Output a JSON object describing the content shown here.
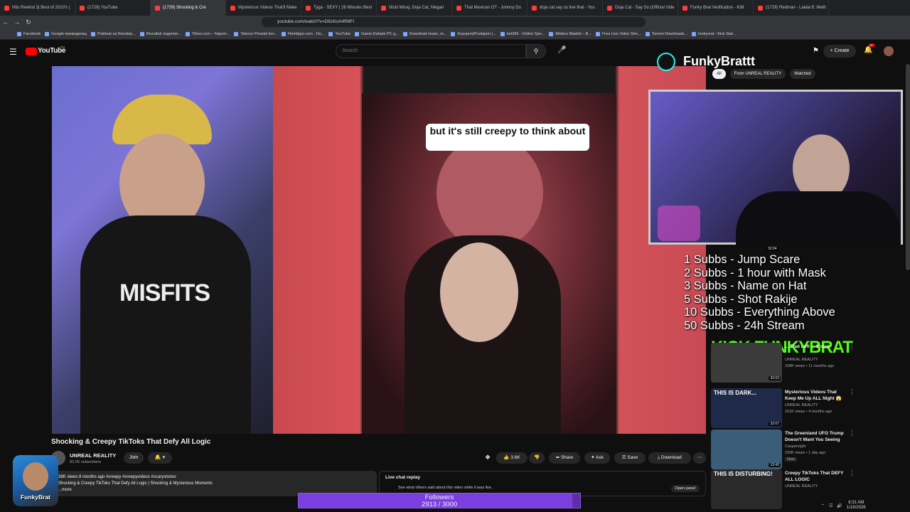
{
  "browser": {
    "tabs": [
      {
        "label": "Hits Rewind 3| Best of 2010's |"
      },
      {
        "label": "(1729) YouTube"
      },
      {
        "label": "(1729) Shocking & Cre",
        "active": true
      },
      {
        "label": "Mysterious Videos That'll Make"
      },
      {
        "label": "Tyga - SEXY | 26 Minutes Best"
      },
      {
        "label": "Nicki Minaj, Doja Cat, Megan"
      },
      {
        "label": "That Mexican OT - Johnny Do"
      },
      {
        "label": "doja cat say so live that - You"
      },
      {
        "label": "Doja Cat - Say So (Official Vide"
      },
      {
        "label": "Funky Brat Verification - Kittl"
      },
      {
        "label": "(1729) Redman - Lalala ft. Meth"
      }
    ],
    "url": "youtube.com/watch?v=D61KvA4R8FI",
    "bookmarks": [
      "Facebook",
      "Google преводилац",
      "Poklони za Nonstop...",
      "Rezultati nogomet...",
      "Titlovi.com – Najveć...",
      "Telenor Privatni kor...",
      "FileHippo.com - Do...",
      "YouTube",
      "Game-Debate PC g...",
      "Download music, m...",
      "Kupujem|Prodajem |...",
      "bet365 - Online Spo...",
      "Atletico Madrid – B...",
      "Free Live Video Stre...",
      "Torrent Downloads...",
      "funkyvrat - Kick Stat..."
    ]
  },
  "youtube": {
    "logo": "YouTube",
    "region": "RS",
    "search_placeholder": "Search",
    "create_label": "Create",
    "notif_count": "9+"
  },
  "video": {
    "caption": "but it's still creepy to think about",
    "title": "Shocking & Creepy TikToks That Defy All Logic",
    "channel": "UNREAL REALITY",
    "subscribers": "93.2K subscribers",
    "join_label": "Join",
    "likes": "3.6K",
    "share_label": "Share",
    "ask_label": "Ask",
    "save_label": "Save",
    "download_label": "Download",
    "desc_meta": "38K views  8 months ago  #creepy #creepyvideos #scarystories",
    "desc_text": "Shocking & Creepy TikToks That Defy All Logic | Shocking & Mysterious Moments",
    "desc_more": "...more"
  },
  "live_chat": {
    "title": "Live chat replay",
    "subtitle": "See what others said about this video while it was live.",
    "open_label": "Open panel"
  },
  "overlay": {
    "tiktok_name": "FunkyBrattt",
    "goals": [
      "1 Subbs - Jump Scare",
      "2 Subbs - 1 hour with Mask",
      "3 Subbs - Name on Hat",
      "5 Subbs - Shot Rakije",
      "10 Subbs - Everything Above",
      "50 Subbs - 24h Stream"
    ],
    "kick_text": "KICK FUNKYBRAT",
    "followers_label": "Followers",
    "followers_value": "2913 / 3000",
    "followers_fraction": 0.971,
    "badge_name": "FunkyBrat"
  },
  "sidebar": {
    "chips": [
      "All",
      "From UNREAL REALITY",
      "Watched"
    ],
    "recs": [
      {
        "title": "... That Left ... Shock",
        "channel": "UNREAL REALITY",
        "meta": "108K views • 11 months ago",
        "duration": "32:03"
      },
      {
        "title": "Mysterious Videos That Keep Me Up ALL Night 😱",
        "channel": "UNREAL REALITY",
        "meta": "101K views • 4 months ago",
        "duration": "32:07",
        "thumb_text": "THIS IS DARK..."
      },
      {
        "title": "The Greenland UFO Trump Doesn't Want You Seeing",
        "channel": "Caspersight",
        "meta": "233K views • 1 day ago",
        "badge": "New",
        "duration": "13:42"
      },
      {
        "title": "Creepy TikToks That DEFY ALL LOGIC",
        "channel": "UNREAL REALITY",
        "meta": "",
        "thumb_text": "THIS IS DISTURBING!"
      }
    ],
    "cam_timestamp": "32:04"
  },
  "system": {
    "time": "8:31 AM",
    "date": "1/16/2026"
  }
}
